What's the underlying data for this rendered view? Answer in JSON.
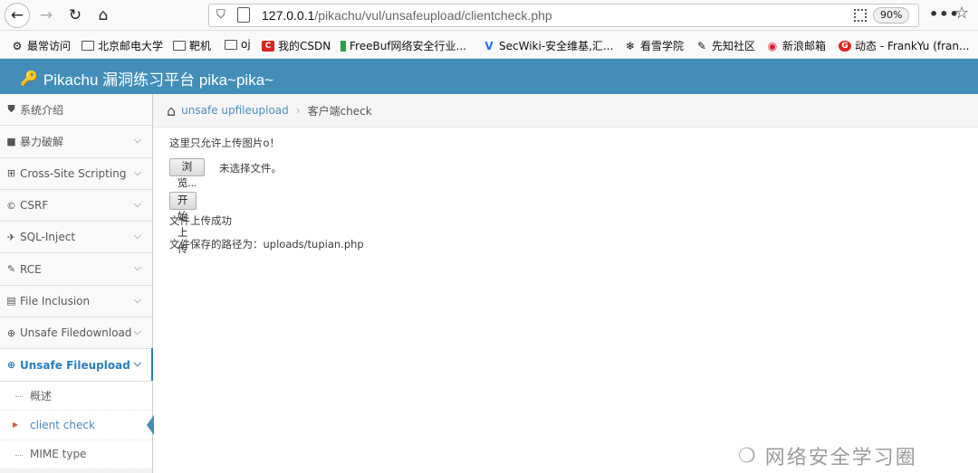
{
  "browser": {
    "url_host": "127.0.0.1",
    "url_path": "/pikachu/vul/unsafeupload/clientcheck.php",
    "zoom": "90%",
    "more": "•••",
    "bookmarks": [
      {
        "label": "最常访问",
        "icon": "gear-icon"
      },
      {
        "label": "北京邮电大学",
        "icon": "folder-icon"
      },
      {
        "label": "靶机",
        "icon": "folder-icon"
      },
      {
        "label": "oj",
        "icon": "folder-icon"
      },
      {
        "label": "我的CSDN",
        "icon": "csdn-icon"
      },
      {
        "label": "FreeBuf网络安全行业...",
        "icon": "freebuf-icon"
      },
      {
        "label": "SecWiki-安全维基,汇...",
        "icon": "secwiki-icon"
      },
      {
        "label": "看雪学院",
        "icon": "snowflake-icon"
      },
      {
        "label": "先知社区",
        "icon": "xianzhi-icon"
      },
      {
        "label": "新浪邮箱",
        "icon": "weibo-icon"
      },
      {
        "label": "动态 - FrankYu (fran...",
        "icon": "g-icon"
      }
    ]
  },
  "app": {
    "title": "Pikachu 漏洞练习平台 pika~pika~",
    "brand_color": "#438eb9"
  },
  "sidebar": {
    "items": [
      {
        "label": "系统介绍",
        "icon": "tags-icon"
      },
      {
        "label": "暴力破解",
        "icon": "lock-icon"
      },
      {
        "label": "Cross-Site Scripting",
        "icon": "sitemap-icon"
      },
      {
        "label": "CSRF",
        "icon": "copyright-icon"
      },
      {
        "label": "SQL-Inject",
        "icon": "plane-icon"
      },
      {
        "label": "RCE",
        "icon": "pencil-icon"
      },
      {
        "label": "File Inclusion",
        "icon": "file-icon"
      },
      {
        "label": "Unsafe Filedownload",
        "icon": "download-circle-icon"
      },
      {
        "label": "Unsafe Fileupload",
        "icon": "upload-circle-icon"
      }
    ],
    "subitems": [
      {
        "label": "概述"
      },
      {
        "label": "client check"
      },
      {
        "label": "MIME type"
      }
    ]
  },
  "breadcrumb": {
    "link": "unsafe upfileupload",
    "current": "客户端check"
  },
  "main": {
    "intro": "这里只允许上传图片o！",
    "browse_label": "浏览...",
    "file_status": "未选择文件。",
    "upload_label": "开始上传",
    "success": "文件上传成功",
    "path_text": "文件保存的路径为：uploads/tupian.php"
  },
  "watermark": "网络安全学习圈"
}
